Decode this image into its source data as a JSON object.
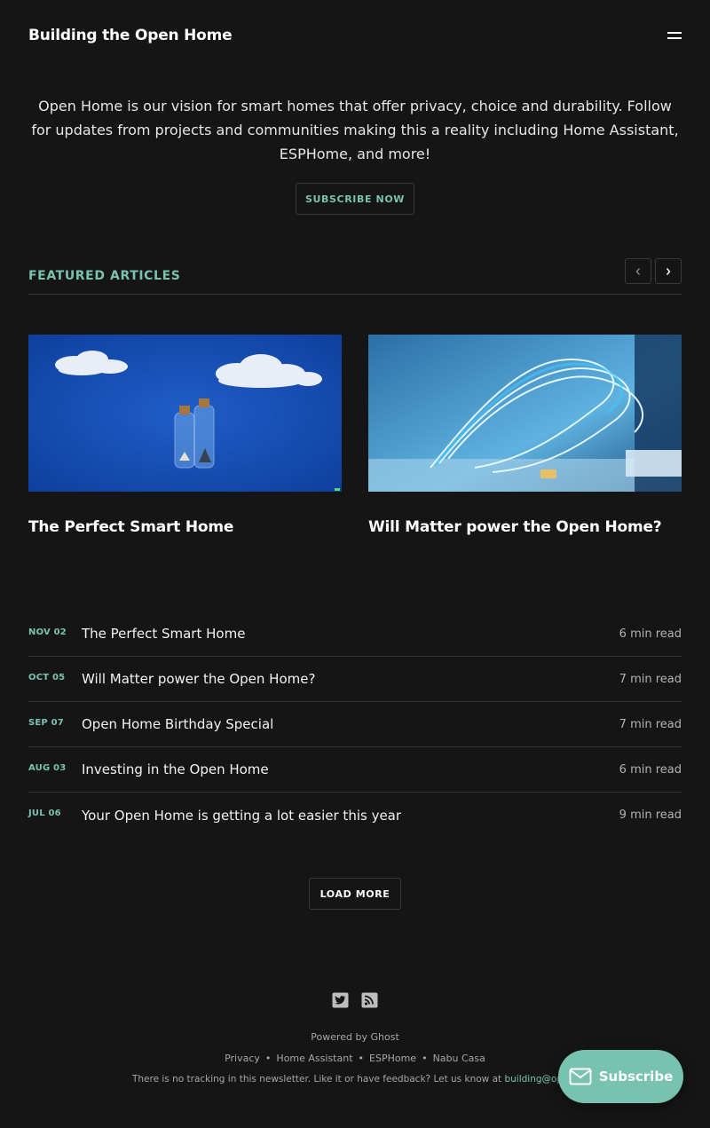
{
  "header": {
    "site_title": "Building the Open Home"
  },
  "intro": {
    "text": "Open Home is our vision for smart homes that offer privacy, choice and durability. Follow for updates from projects and communities making this a reality including Home Assistant, ESPHome, and more!",
    "subscribe_label": "SUBSCRIBE NOW"
  },
  "featured": {
    "heading": "FEATURED ARTICLES",
    "cards": [
      {
        "title": "The Perfect Smart Home"
      },
      {
        "title": "Will Matter power the Open Home?"
      }
    ]
  },
  "posts": [
    {
      "date": "NOV 02",
      "title": "The Perfect Smart Home",
      "read": "6 min read"
    },
    {
      "date": "OCT 05",
      "title": "Will Matter power the Open Home?",
      "read": "7 min read"
    },
    {
      "date": "SEP 07",
      "title": "Open Home Birthday Special",
      "read": "7 min read"
    },
    {
      "date": "AUG 03",
      "title": "Investing in the Open Home",
      "read": "6 min read"
    },
    {
      "date": "JUL 06",
      "title": "Your Open Home is getting a lot easier this year",
      "read": "9 min read"
    }
  ],
  "load_more_label": "LOAD MORE",
  "footer": {
    "powered": "Powered by Ghost",
    "links": [
      "Privacy",
      "Home Assistant",
      "ESPHome",
      "Nabu Casa"
    ],
    "feedback_text": "There is no tracking in this newsletter. Like it or have feedback? Let us know at",
    "feedback_email": "building@open-"
  },
  "portal": {
    "label": "Subscribe"
  },
  "icons": {
    "menu": "hamburger-menu-icon",
    "prev": "chevron-left-icon",
    "next": "chevron-right-icon",
    "twitter": "twitter-icon",
    "rss": "rss-icon",
    "mail": "mail-icon"
  },
  "colors": {
    "background": "#151515",
    "accent": "#78c2b0"
  }
}
